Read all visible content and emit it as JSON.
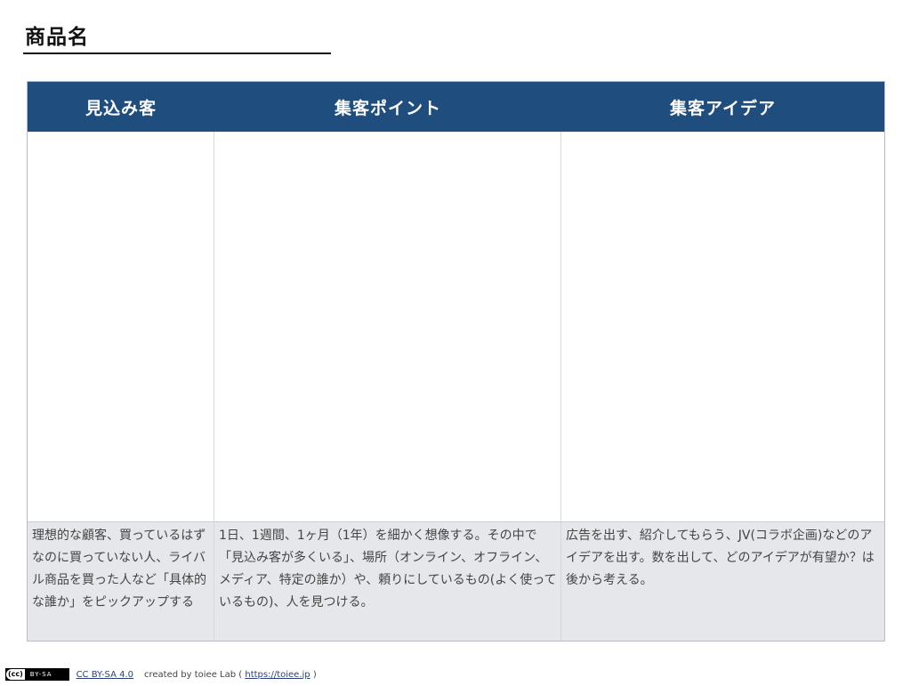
{
  "page": {
    "title": "商品名"
  },
  "columns": [
    {
      "header": "見込み客",
      "hint": "理想的な顧客、買っているはずなのに買っていない人、ライバル商品を買った人など「具体的な誰か」をピックアップする"
    },
    {
      "header": "集客ポイント",
      "hint": "1日、1週間、1ヶ月（1年）を細かく想像する。その中で「見込み客が多くいる」、場所（オンライン、オフライン、メディア、特定の誰か）や、頼りにしているもの(よく使っているもの)、人を見つける。"
    },
    {
      "header": "集客アイデア",
      "hint": "広告を出す、紹介してもらう、JV(コラボ企画)などのアイデアを出す。数を出して、どのアイデアが有望か？は後から考える。"
    }
  ],
  "footer": {
    "badge_logo": "(cc)",
    "badge_text": "BY-SA",
    "license_link": "CC BY-SA 4.0",
    "credit_prefix": "created by toiee Lab (",
    "credit_link": "https://toiee.jp",
    "credit_suffix": ")"
  },
  "colors": {
    "header_bg": "#1f4e7e",
    "hint_bg": "#e6e7ea"
  }
}
